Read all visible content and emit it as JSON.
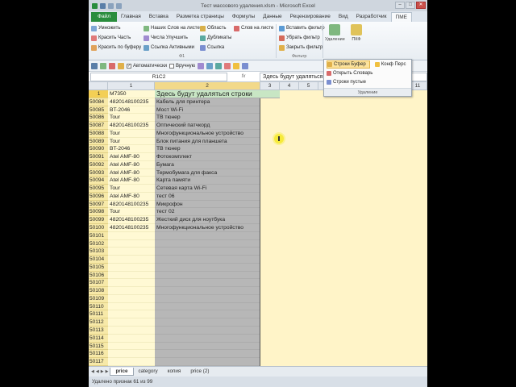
{
  "window": {
    "title": "Тест массового удаления.xlsm - Microsoft Excel",
    "min": "–",
    "max": "□",
    "close": "✕"
  },
  "ribbon_tabs": [
    "Файл",
    "Главная",
    "Вставка",
    "Разметка страницы",
    "Формулы",
    "Данные",
    "Рецензирование",
    "Вид",
    "Разработчик",
    "ПМЕ"
  ],
  "ribbon": {
    "col1": [
      "Умножить",
      "Красить Часть",
      "Красить по буферу"
    ],
    "col2": [
      "Наших Слов на листе",
      "Числа Улучшить",
      "Ссылка Активными"
    ],
    "col3": [
      "Область",
      "Дубликаты",
      "Ссылка"
    ],
    "col4": [
      "Слов на листе"
    ],
    "group1_label": "Ф1",
    "col5": [
      "Вставить фильтр",
      "Убрать фильтр",
      "Закрыть фильтр"
    ],
    "group2_label": "Фильтр",
    "big1": "Удаление",
    "big2": "ПКФ"
  },
  "toolbar2": {
    "auto_label": "Автоматически",
    "manual_label": "Вручную"
  },
  "formula_bar": {
    "name_box": "R1C2",
    "fx": "fx",
    "content": "Здесь будут удаляться строки"
  },
  "columns": [
    "1",
    "2",
    "3",
    "4",
    "5",
    "11"
  ],
  "rows": [
    {
      "n": "1",
      "a": "M7350",
      "b": "Здесь будут удаляться строки"
    },
    {
      "n": "50084",
      "a": "4820148100235",
      "b": "Кабель для принтера"
    },
    {
      "n": "50085",
      "a": "BT-2046",
      "b": "Мост Wi-Fi"
    },
    {
      "n": "50086",
      "a": "Tour",
      "b": "ТВ тюнер"
    },
    {
      "n": "50087",
      "a": "4820148100235",
      "b": "Оптический патчкорд"
    },
    {
      "n": "50088",
      "a": "Tour",
      "b": "Многофункциональное устройство"
    },
    {
      "n": "50089",
      "a": "Tour",
      "b": "Блок питания для планшета"
    },
    {
      "n": "50090",
      "a": "BT-2046",
      "b": "ТВ тюнер"
    },
    {
      "n": "50091",
      "a": "Atel AMF-80",
      "b": "Фотокомплект"
    },
    {
      "n": "50092",
      "a": "Atel AMF-80",
      "b": "Бумага"
    },
    {
      "n": "50093",
      "a": "Atel AMF-80",
      "b": "Термобумага для факса"
    },
    {
      "n": "50094",
      "a": "Atel AMF-80",
      "b": "Карта памяти"
    },
    {
      "n": "50095",
      "a": "Tour",
      "b": "Сетевая карта Wi-Fi"
    },
    {
      "n": "50096",
      "a": "Atel AMF-80",
      "b": "тест 06"
    },
    {
      "n": "50097",
      "a": "4820148100235",
      "b": "Микрофон"
    },
    {
      "n": "50098",
      "a": "Tour",
      "b": "тест 02"
    },
    {
      "n": "50099",
      "a": "4820148100235",
      "b": "Жесткий диск для ноутбука"
    },
    {
      "n": "50100",
      "a": "4820148100235",
      "b": "Многофункциональное устройство"
    },
    {
      "n": "50101",
      "a": "",
      "b": ""
    },
    {
      "n": "50102",
      "a": "",
      "b": ""
    },
    {
      "n": "50103",
      "a": "",
      "b": ""
    },
    {
      "n": "50104",
      "a": "",
      "b": ""
    },
    {
      "n": "50105",
      "a": "",
      "b": ""
    },
    {
      "n": "50106",
      "a": "",
      "b": ""
    },
    {
      "n": "50107",
      "a": "",
      "b": ""
    },
    {
      "n": "50108",
      "a": "",
      "b": ""
    },
    {
      "n": "50109",
      "a": "",
      "b": ""
    },
    {
      "n": "50110",
      "a": "",
      "b": ""
    },
    {
      "n": "50111",
      "a": "",
      "b": ""
    },
    {
      "n": "50112",
      "a": "",
      "b": ""
    },
    {
      "n": "50113",
      "a": "",
      "b": ""
    },
    {
      "n": "50114",
      "a": "",
      "b": ""
    },
    {
      "n": "50115",
      "a": "",
      "b": ""
    },
    {
      "n": "50116",
      "a": "",
      "b": ""
    },
    {
      "n": "50117",
      "a": "",
      "b": ""
    }
  ],
  "dropdown": {
    "item1": "Строки Буфер",
    "item2": "Конф Перс",
    "item3": "Открыть Словарь",
    "item4": "Строки пустые",
    "footer": "Удаление"
  },
  "sheet_tabs": [
    "price",
    "category",
    "копия",
    "price (2)"
  ],
  "status": "Удалено признак 61 из 99",
  "colors": {
    "file_tab": "#2a8d3d",
    "row_header": "#f7e9a8",
    "gray_column": "#b7b7b7",
    "header_cell": "#c8e6c4",
    "cursor": "#f6ea3b"
  }
}
